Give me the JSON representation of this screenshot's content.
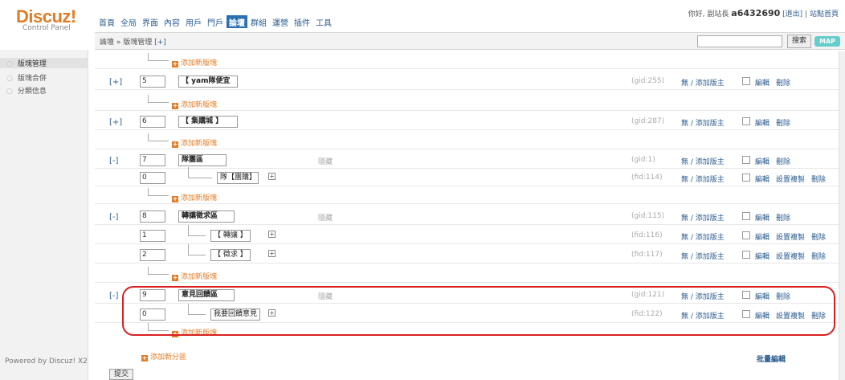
{
  "header": {
    "logo": "Discuz!",
    "logo_sub": "Control Panel",
    "nav": [
      "首頁",
      "全局",
      "界面",
      "內容",
      "用戶",
      "門戶",
      "論壇",
      "群組",
      "運營",
      "插件",
      "工具"
    ],
    "active_nav": "論壇",
    "greeting": "你好, 副站長",
    "username": "a6432690",
    "logout": "[退出]",
    "home": "站點首頁"
  },
  "subbar": {
    "breadcrumb": "論壇 » 版塊管理",
    "add": "[+]",
    "search_button": "搜索",
    "map_button": "MAP"
  },
  "sidebar": {
    "items": [
      "版塊管理",
      "版塊合併",
      "分類信息"
    ],
    "powered": "Powered by Discuz! X2"
  },
  "labels": {
    "add_board": "添加新版塊",
    "add_zone": "添加新分區",
    "hidden": "隱藏",
    "moderator": "無 / 添加版主",
    "edit": "編輯",
    "delete": "刪除",
    "copy_settings": "設置複製",
    "batch_edit": "批量編輯",
    "submit": "提交"
  },
  "rows": [
    {
      "toggle": "[+]",
      "order": "5",
      "name": "【 yam隊便宜",
      "gid": "(gid:255)"
    },
    {
      "toggle": "[+]",
      "order": "6",
      "name": "【 集購城 】",
      "gid": "(gid:287)"
    },
    {
      "toggle": "[-]",
      "order": "7",
      "name": "隊團區",
      "gid": "(gid:1)"
    },
    {
      "order": "0",
      "name": "隊【團購】",
      "gid": "(fid:114)"
    },
    {
      "toggle": "[-]",
      "order": "8",
      "name": "轉讓徵求區",
      "gid": "(gid:115)"
    },
    {
      "order": "1",
      "name": "【 轉讓 】",
      "gid": "(fid:116)"
    },
    {
      "order": "2",
      "name": "【 徵求 】",
      "gid": "(fid:117)"
    },
    {
      "toggle": "[-]",
      "order": "9",
      "name": "意見回饋區",
      "gid": "(gid:121)"
    },
    {
      "order": "0",
      "name": "我要回饋意見",
      "gid": "(fid:122)"
    }
  ]
}
